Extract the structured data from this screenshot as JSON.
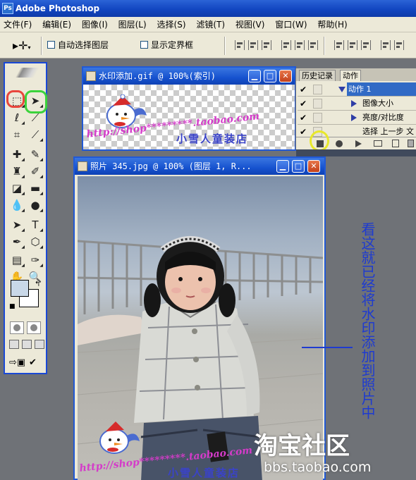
{
  "app": {
    "title": "Adobe Photoshop",
    "icon": "photoshop-icon"
  },
  "menu": {
    "items": [
      "文件(F)",
      "编辑(E)",
      "图像(I)",
      "图层(L)",
      "选择(S)",
      "滤镜(T)",
      "视图(V)",
      "窗口(W)",
      "帮助(H)"
    ]
  },
  "options": {
    "auto_select_label": "自动选择图层",
    "show_bounds_label": "显示定界框",
    "auto_select_checked": false,
    "show_bounds_checked": false
  },
  "gif_window": {
    "title": "水印添加.gif @ 100%(索引)"
  },
  "watermark": {
    "url_text": "http://shop*********.taobao.com",
    "shop_name": "小雪人童装店"
  },
  "panel": {
    "tabs": [
      "历史记录",
      "动作"
    ],
    "rows": [
      {
        "label": "动作 1",
        "checked": true,
        "selected": true
      },
      {
        "label": "图像大小",
        "checked": true,
        "selected": false
      },
      {
        "label": "亮度/对比度",
        "checked": true,
        "selected": false
      },
      {
        "label": "选择 上一步 文",
        "checked": true,
        "selected": false
      }
    ]
  },
  "photo_window": {
    "title": "照片 345.jpg @ 100% (图层 1, R..."
  },
  "annotation": {
    "text": "看这就已经将水印添加到照片中",
    "color": "#1e3bd0"
  },
  "site_watermark": {
    "brand": "淘宝社区",
    "url": "bbs.taobao.com"
  },
  "colors": {
    "titlebar": "#1246c1",
    "highlight_red": "#e8463c",
    "highlight_green": "#3bd33b",
    "highlight_yellow": "#e8e82a",
    "watermark_pink": "#d43bc9"
  }
}
